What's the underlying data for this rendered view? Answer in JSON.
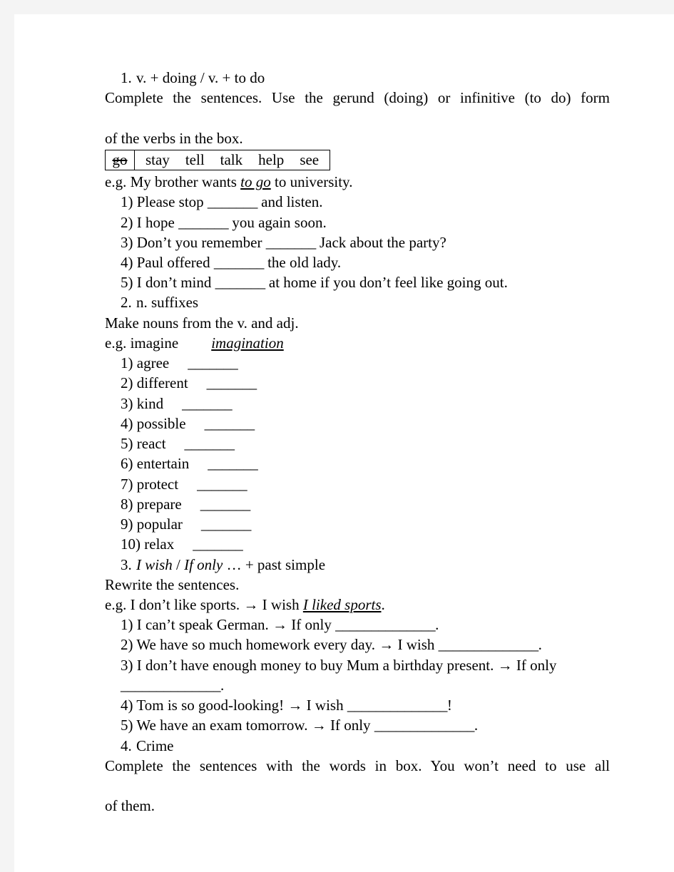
{
  "page": {
    "background_color": "#ffffff",
    "canvas_color": "#f4f4f4",
    "text_color": "#000000"
  },
  "sections": [
    {
      "number": "1.",
      "title": "v. + doing / v. + to do",
      "instruction": "Complete the sentences. Use the gerund (doing) or infinitive (to do) form",
      "instruction_line2": "of the verbs in the box.",
      "wordbox": {
        "struck_word": "go",
        "words": [
          "stay",
          "tell",
          "talk",
          "help",
          "see"
        ]
      },
      "example_prefix": "e.g. My brother wants ",
      "example_answer": "to go",
      "example_suffix": " to university.",
      "items": [
        {
          "marker": "1)",
          "before": "Please stop ",
          "blank": "_______",
          "after": " and listen."
        },
        {
          "marker": "2)",
          "before": "I hope ",
          "blank": "_______",
          "after": " you again soon."
        },
        {
          "marker": "3)",
          "before": "Don’t you remember ",
          "blank": "_______",
          "after": " Jack about the party?"
        },
        {
          "marker": "4)",
          "before": "Paul offered ",
          "blank": "_______",
          "after": " the old lady."
        },
        {
          "marker": "5)",
          "before": "I don’t mind ",
          "blank": "_______",
          "after": " at home if you don’t feel like going out."
        }
      ]
    },
    {
      "number": "2.",
      "title": "n. suffixes",
      "instruction": "Make nouns from the v. and adj.",
      "example_prefix": "e.g. imagine",
      "example_answer": "imagination",
      "items": [
        {
          "marker": "1)",
          "word": "agree",
          "blank": "_______"
        },
        {
          "marker": "2)",
          "word": "different",
          "blank": "_______"
        },
        {
          "marker": "3)",
          "word": "kind",
          "blank": "_______"
        },
        {
          "marker": "4)",
          "word": "possible",
          "blank": "_______"
        },
        {
          "marker": "5)",
          "word": "react",
          "blank": "_______"
        },
        {
          "marker": "6)",
          "word": "entertain",
          "blank": "_______"
        },
        {
          "marker": "7)",
          "word": "protect",
          "blank": "_______"
        },
        {
          "marker": "8)",
          "word": "prepare",
          "blank": "_______"
        },
        {
          "marker": "9)",
          "word": "popular",
          "blank": "_______"
        },
        {
          "marker": "10)",
          "word": "relax",
          "blank": "_______"
        }
      ]
    },
    {
      "number": "3.",
      "title_italic_1": "I wish",
      "title_sep": " / ",
      "title_italic_2": "If only",
      "title_rest": " … + past simple",
      "instruction": "Rewrite the sentences.",
      "example_prefix": "e.g. I don’t like sports. → I wish ",
      "example_answer": "I liked sports",
      "example_suffix": ".",
      "items": [
        {
          "marker": "1)",
          "before": "I can’t speak German. → If only ",
          "blank": "______________",
          "after": "."
        },
        {
          "marker": "2)",
          "before": "We have so much homework every day. → I wish ",
          "blank": "______________",
          "after": "."
        },
        {
          "marker": "3)",
          "before": "I don’t have enough money to buy Mum a birthday present. → If only ",
          "blank": "______________",
          "after": "."
        },
        {
          "marker": "4)",
          "before": "Tom is so good-looking! → I wish ",
          "blank": "______________",
          "after": "!"
        },
        {
          "marker": "5)",
          "before": "We have an exam tomorrow. → If only ",
          "blank": "______________",
          "after": "."
        }
      ]
    },
    {
      "number": "4.",
      "title": "Crime",
      "instruction": "Complete the sentences with the words in box. You won’t need to use all",
      "instruction_line2": "of them."
    }
  ]
}
